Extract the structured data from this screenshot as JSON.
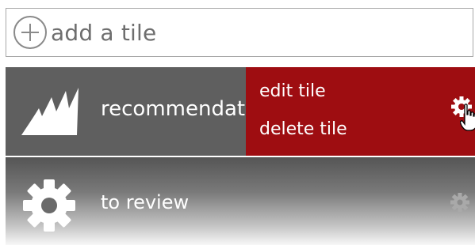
{
  "add_bar": {
    "label": "add a tile",
    "icon": "plus-circle-icon"
  },
  "tiles": [
    {
      "label": "recommendati",
      "icon": "analytics-logo-icon",
      "settings_icon": "gear-icon",
      "menu": {
        "items": [
          {
            "label": "edit tile"
          },
          {
            "label": "delete tile"
          }
        ]
      }
    },
    {
      "label": "to review",
      "icon": "gear-icon",
      "settings_icon": "gear-icon"
    }
  ],
  "colors": {
    "tile_bg": "#5f5f5f",
    "menu_bg": "#9e0d11",
    "text_light": "#ffffff",
    "add_text": "#6e6e6e"
  }
}
